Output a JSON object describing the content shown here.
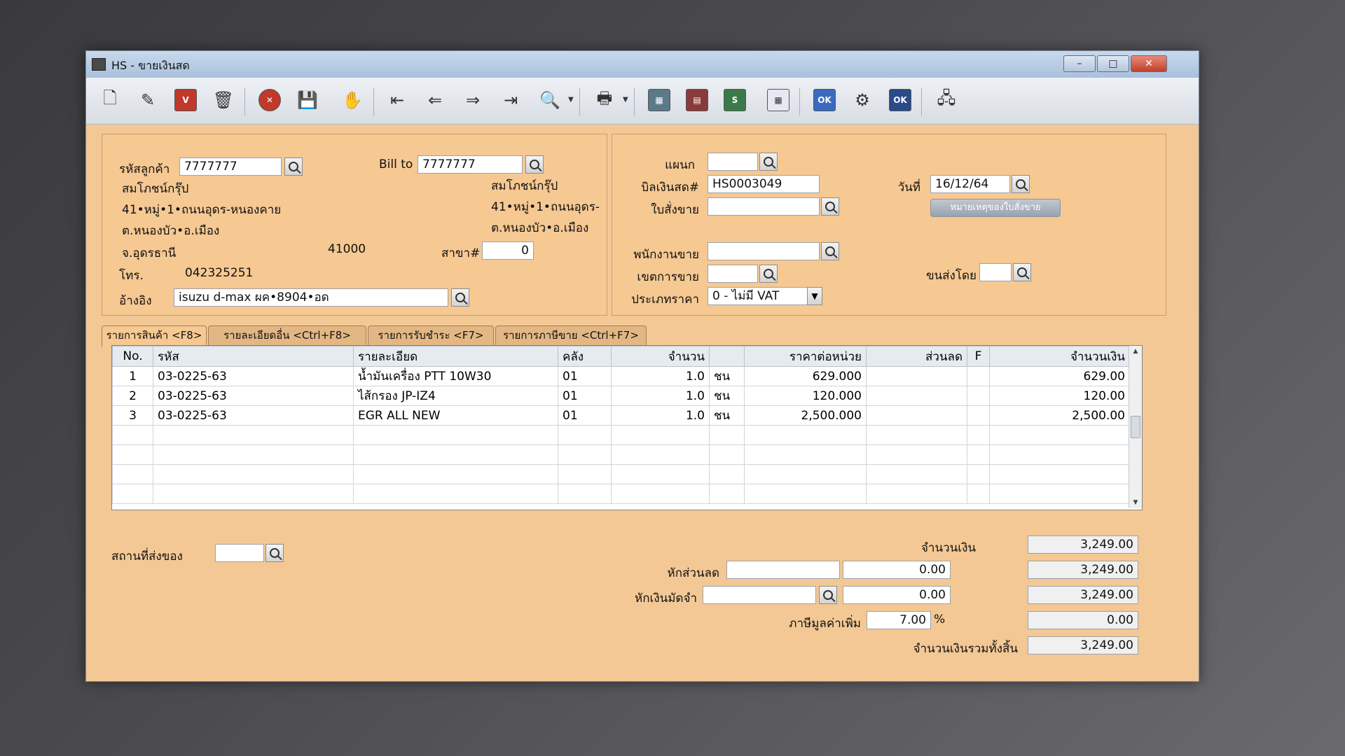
{
  "window": {
    "title": "HS - ขายเงินสด"
  },
  "customer": {
    "code_label": "รหัสลูกค้า",
    "code": "7777777",
    "name": "สมโภชน์กรุ๊ป",
    "addr1": "41•หมู่•1•ถนนอุดร-หนองคาย",
    "addr2": "ต.หนองบัว•อ.เมือง",
    "province": "จ.อุดรธานี",
    "zip": "41000",
    "phone_label": "โทร.",
    "phone": "042325251",
    "ref_label": "อ้างอิง",
    "ref": "isuzu d-max ผค•8904•อด"
  },
  "billto": {
    "label": "Bill to",
    "code": "7777777",
    "name": "สมโภชน์กรุ๊ป",
    "addr1": "41•หมู่•1•ถนนอุดร-",
    "addr2": "ต.หนองบัว•อ.เมือง",
    "branch_label": "สาขา#",
    "branch": "0"
  },
  "doc": {
    "dept_label": "แผนก",
    "dept": "",
    "cashbill_label": "บิลเงินสด#",
    "cashbill": "HS0003049",
    "order_label": "ใบสั่งขาย",
    "order": "",
    "date_label": "วันที่",
    "date": "16/12/64",
    "note_button": "หมายเหตุของใบสั่งขาย",
    "salesman_label": "พนักงานขาย",
    "salesman": "",
    "area_label": "เขตการขาย",
    "area": "",
    "shipby_label": "ขนส่งโดย",
    "shipby": "",
    "pricetype_label": "ประเภทราคา",
    "pricetype": "0 - ไม่มี VAT"
  },
  "tabs": [
    {
      "label": "รายการสินค้า <F8>"
    },
    {
      "label": "รายละเอียดอื่น <Ctrl+F8>"
    },
    {
      "label": "รายการรับชำระ <F7>"
    },
    {
      "label": "รายการภาษีขาย <Ctrl+F7>"
    }
  ],
  "table": {
    "headers": [
      "No.",
      "รหัส",
      "รายละเอียด",
      "คลัง",
      "จำนวน",
      "",
      "ราคาต่อหน่วย",
      "ส่วนลด",
      "F",
      "จำนวนเงิน"
    ],
    "rows": [
      [
        "1",
        "03-0225-63",
        "น้ำมันเครื่อง PTT 10W30",
        "01",
        "1.0",
        "ชน",
        "629.000",
        "",
        "",
        "629.00"
      ],
      [
        "2",
        "03-0225-63",
        "ไส้กรอง JP-IZ4",
        "01",
        "1.0",
        "ชน",
        "120.000",
        "",
        "",
        "120.00"
      ],
      [
        "3",
        "03-0225-63",
        "EGR ALL NEW",
        "01",
        "1.0",
        "ชน",
        "2,500.000",
        "",
        "",
        "2,500.00"
      ]
    ]
  },
  "footer": {
    "shipto_label": "สถานที่ส่งของ",
    "shipto": "",
    "amount_label": "จำนวนเงิน",
    "amount": "3,249.00",
    "discount_label": "หักส่วนลด",
    "discount_text": "",
    "discount_value": "0.00",
    "after_discount": "3,249.00",
    "deposit_label": "หักเงินมัดจำ",
    "deposit_text": "",
    "deposit_value": "0.00",
    "after_deposit": "3,249.00",
    "vat_label": "ภาษีมูลค่าเพิ่ม",
    "vat_rate": "7.00",
    "vat_pct": "%",
    "vat_amount": "0.00",
    "total_label": "จำนวนเงินรวมทั้งสิ้น",
    "total": "3,249.00"
  }
}
